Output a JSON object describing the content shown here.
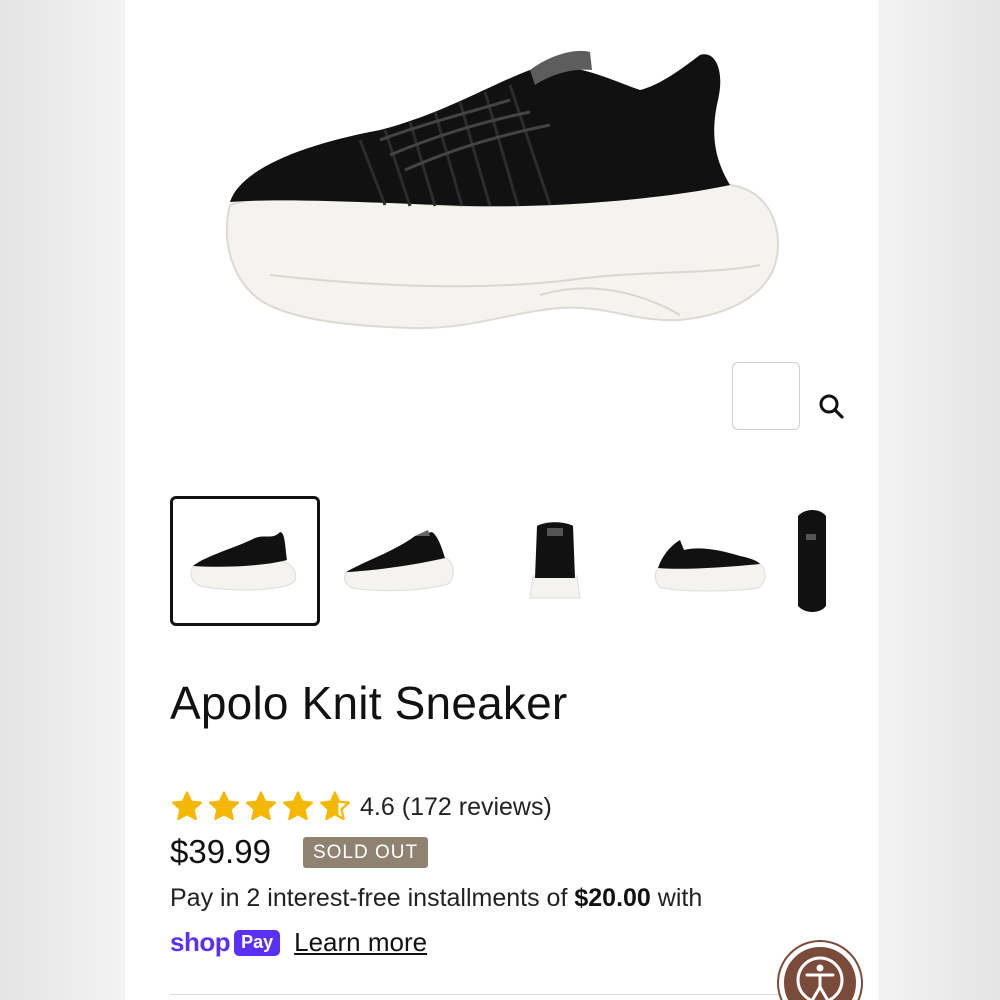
{
  "product": {
    "title": "Apolo Knit Sneaker",
    "rating_value": "4.6",
    "rating_count": "(172 reviews)",
    "rating_stars": 4.6,
    "price": "$39.99",
    "status_badge": "SOLD OUT"
  },
  "payment": {
    "text_before": "Pay in 2 interest-free installments of ",
    "amount": "$20.00",
    "text_after": " with",
    "shop_word": "shop",
    "pay_word": "Pay",
    "learn_more": "Learn more"
  },
  "gallery": {
    "active_index": 0,
    "thumbnail_count": 5
  },
  "colors": {
    "badge": "#8f8270",
    "shop_pay": "#5a31f4",
    "star": "#f5b800",
    "accessibility": "#7a4a3a"
  },
  "icons": {
    "zoom": "search-icon",
    "accessibility": "accessibility-icon",
    "rating": "star-icon"
  }
}
